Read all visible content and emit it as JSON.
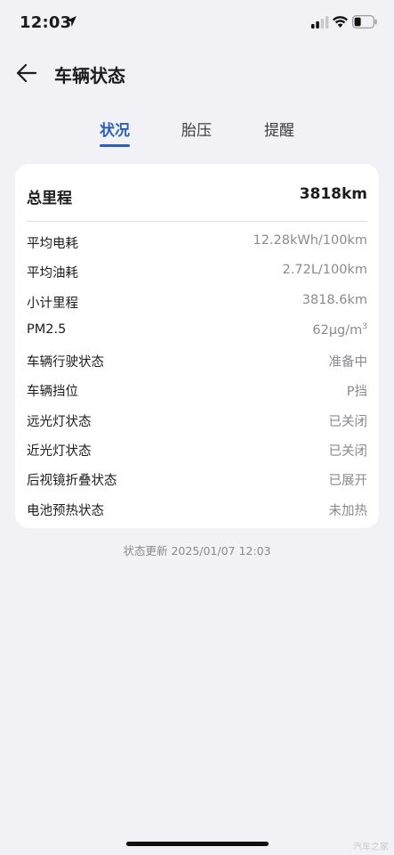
{
  "status_bar": {
    "time": "12:03"
  },
  "header": {
    "title": "车辆状态"
  },
  "tabs": [
    {
      "label": "状况",
      "active": true
    },
    {
      "label": "胎压",
      "active": false
    },
    {
      "label": "提醒",
      "active": false
    }
  ],
  "card": {
    "total": {
      "label": "总里程",
      "value": "3818km"
    },
    "rows": [
      {
        "label": "平均电耗",
        "value": "12.28kWh/100km"
      },
      {
        "label": "平均油耗",
        "value": "2.72L/100km"
      },
      {
        "label": "小计里程",
        "value": "3818.6km"
      },
      {
        "label": "PM2.5",
        "value": "62μg/m",
        "sup": "3"
      },
      {
        "label": "车辆行驶状态",
        "value": "准备中"
      },
      {
        "label": "车辆挡位",
        "value": "P挡"
      },
      {
        "label": "远光灯状态",
        "value": "已关闭"
      },
      {
        "label": "近光灯状态",
        "value": "已关闭"
      },
      {
        "label": "后视镜折叠状态",
        "value": "已展开"
      },
      {
        "label": "电池预热状态",
        "value": "未加热"
      }
    ]
  },
  "update_text": "状态更新 2025/01/07 12:03",
  "watermark": "汽车之家",
  "colors": {
    "accent": "#2a5fbf",
    "background": "#f2f2f6",
    "card": "#ffffff",
    "muted": "#8a8a90"
  },
  "icons": {
    "back": "arrow-left-icon",
    "location": "location-arrow-icon",
    "signal": "cellular-signal-icon",
    "wifi": "wifi-icon",
    "battery": "battery-icon"
  }
}
